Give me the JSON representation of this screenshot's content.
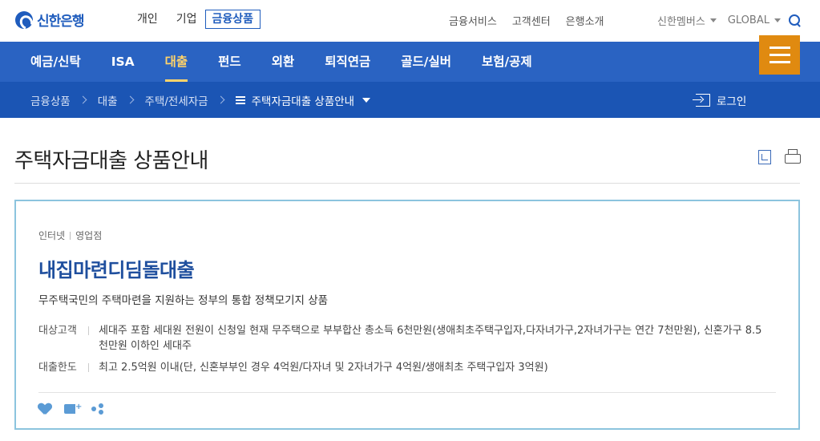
{
  "header": {
    "logo_text": "신한은행",
    "tabs": [
      {
        "label": "개인"
      },
      {
        "label": "기업"
      },
      {
        "label": "금융상품"
      }
    ],
    "util_links": [
      "금융서비스",
      "고객센터",
      "은행소개"
    ],
    "members_label": "신한멤버스",
    "global_label": "GLOBAL"
  },
  "nav": {
    "items": [
      "예금/신탁",
      "ISA",
      "대출",
      "펀드",
      "외환",
      "퇴직연금",
      "골드/실버",
      "보험/공제"
    ],
    "active_index": 2
  },
  "breadcrumb": {
    "items": [
      "금융상품",
      "대출",
      "주택/전세자금"
    ],
    "current": "주택자금대출 상품안내",
    "login_label": "로그인"
  },
  "page": {
    "title": "주택자금대출 상품안내"
  },
  "product": {
    "channel_1": "인터넷",
    "channel_2": "영업점",
    "name": "내집마련디딤돌대출",
    "description": "무주택국민의 주택마련을 지원하는 정부의 통합 정책모기지 상품",
    "target_label": "대상고객",
    "target_value": "세대주 포함 세대원 전원이 신청일 현재 무주택으로 부부합산 총소득 6천만원(생애최초주택구입자,다자녀가구,2자녀가구는 연간 7천만원), 신혼가구 8.5천만원 이하인 세대주",
    "limit_label": "대출한도",
    "limit_value": "최고 2.5억원 이내(단, 신혼부부인 경우 4억원/다자녀 및 2자녀가구 4억원/생애최초 주택구입자 3억원)"
  },
  "colors": {
    "brand": "#1f5cbd",
    "nav_bg": "#2a63c2",
    "crumb_bg": "#1b55b4",
    "active_nav": "#ffd36a",
    "menu_button": "#e08a10",
    "card_border": "#8cc4de"
  },
  "icons": [
    "search-icon",
    "menu-icon",
    "list-icon",
    "login-icon",
    "download-icon",
    "print-icon",
    "heart-icon",
    "tag-add-icon",
    "share-icon"
  ]
}
